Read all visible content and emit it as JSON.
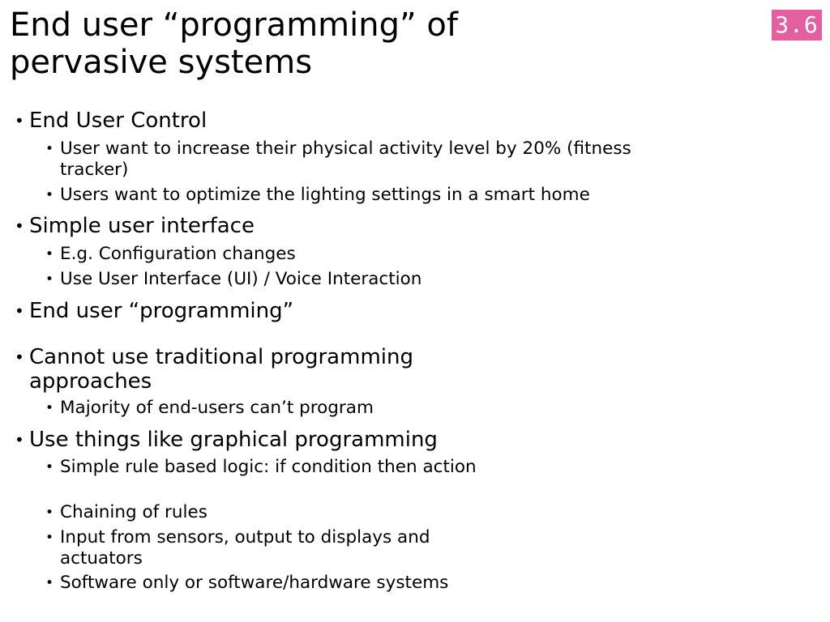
{
  "slide": {
    "title": "End user “programming” of pervasive systems",
    "number": "3.6",
    "badge_color": "#e35fa0"
  },
  "content": [
    {
      "text": "End User Control"
    },
    {
      "text": "User want to increase their physical activity level by 20% (fitness tracker)"
    },
    {
      "text": "Users want to optimize the lighting settings in a smart home"
    },
    {
      "text": "Simple user interface"
    },
    {
      "text": "E.g. Configuration changes"
    },
    {
      "text": "Use User Interface (UI) / Voice Interaction"
    },
    {
      "text": "End user “programming”"
    },
    {
      "text": "Cannot use traditional programming approaches"
    },
    {
      "text": "Majority of end-users can’t program"
    },
    {
      "text": "Use things like graphical programming"
    },
    {
      "text": "Simple rule based logic: if condition then action"
    },
    {
      "text": "Chaining of rules"
    },
    {
      "text": "Input from sensors, output to displays and actuators"
    },
    {
      "text": "Software only or software/hardware systems"
    }
  ]
}
